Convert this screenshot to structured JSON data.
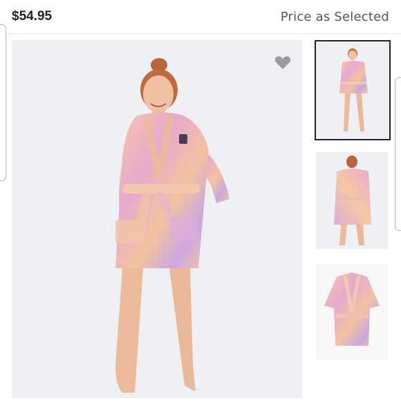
{
  "product": {
    "price": "$54.95",
    "price_note": "Price as Selected"
  },
  "icons": {
    "favorite": "heart-icon"
  },
  "gallery": {
    "selected_index": 0,
    "thumbnails": [
      "front-view",
      "back-view",
      "flat-lay"
    ]
  },
  "colors": {
    "background": "#eef0f3",
    "robe_pink": "#e7a9cf",
    "robe_peach": "#f6c7a4",
    "robe_lilac": "#c9a6df",
    "heart": "#9b9b9b"
  }
}
